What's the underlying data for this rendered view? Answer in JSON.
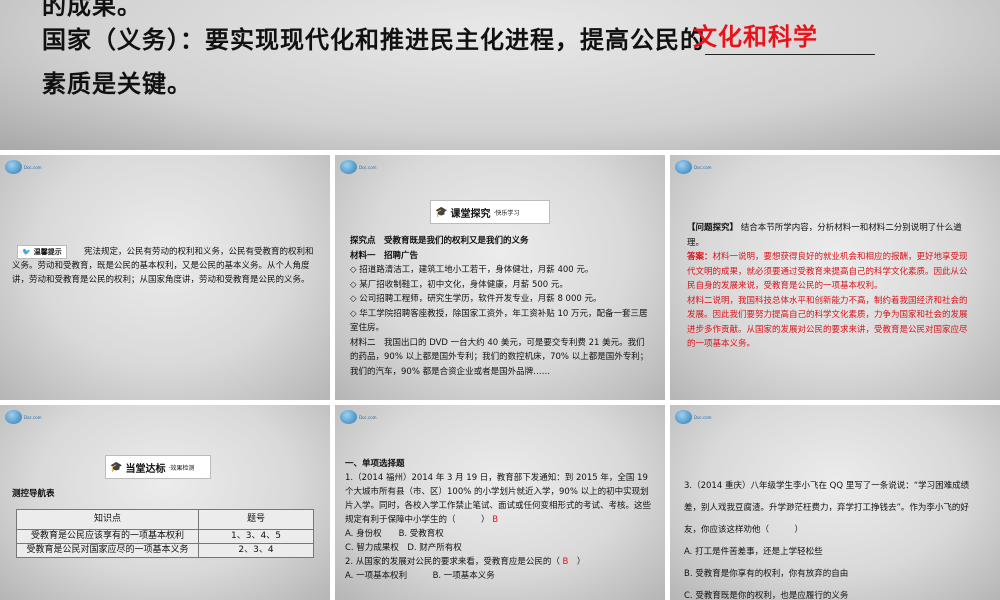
{
  "slides": [
    {
      "top_cut": "的成果。",
      "line1": "国家（义务）：要实现现代化和推进民主化进程，提高公民的",
      "answer": "文化和科学",
      "line2": "素质是关键。"
    },
    {
      "badge": "温馨提示",
      "text": "宪法规定，公民有劳动的权利和义务，公民有受教育的权利和义务。劳动和受教育，既是公民的基本权利，又是公民的基本义务。从个人角度讲，劳动和受教育是公民的权利；从国家角度讲，劳动和受教育是公民的义务。"
    },
    {
      "banner": "课堂探究",
      "banner_sub": "·快乐学习",
      "lines": [
        "探究点　受教育既是我们的权利又是我们的义务",
        "材料一　招聘广告",
        "◇ 招道路清洁工，建筑工地小工若干，身体健壮，月薪 400 元。",
        "◇ 某厂招收制鞋工，初中文化，身体健康，月薪 500 元。",
        "◇ 公司招聘工程师，研究生学历，软件开发专业，月薪 8 000 元。",
        "◇ 华工学院招聘客座教授，除国家工资外，年工资补贴 10 万元，配备一套三居室住房。",
        "材料二　我国出口的 DVD 一台大约 40 美元，可是要交专利费 21 美元。我们的药品，90% 以上都是国外专利；我们的数控机床，70% 以上都是国外专利；我们的汽车，90% 都是合资企业或者是国外品牌……"
      ]
    },
    {
      "label": "【问题探究】",
      "question": "结合本节所学内容，分析材料一和材料二分别说明了什么道理。",
      "answer_label": "答案：",
      "answer1": "材料一说明，要想获得良好的就业机会和相应的报酬，更好地享受现代文明的成果，就必须要通过受教育来提高自己的科学文化素质。因此从公民自身的发展来说，受教育是公民的一项基本权利。",
      "answer2": "材料二说明，我国科技总体水平和创新能力不高，制约着我国经济和社会的发展。因此我们要努力提高自己的科学文化素质，力争为国家和社会的发展进步多作贡献。从国家的发展对公民的要求来讲，受教育是公民对国家应尽的一项基本义务。"
    },
    {
      "banner": "当堂达标",
      "banner_sub": "·效果检测",
      "title": "测控导航表",
      "headers": [
        "知识点",
        "题号"
      ],
      "rows": [
        [
          "受教育是公民应该享有的一项基本权利",
          "1、3、4、5"
        ],
        [
          "受教育是公民对国家应尽的一项基本义务",
          "2、3、4"
        ]
      ]
    },
    {
      "section": "一、单项选择题",
      "q1": "1.（2014 福州）2014 年 3 月 19 日，教育部下发通知：到 2015 年，全国 19 个大城市所有县（市、区）100% 的小学划片就近入学，90% 以上的初中实现划片入学。同时，各校入学工作禁止笔试、面试或任何变相形式的考试、考核。这些规定有利于保障中小学生的（　　　）",
      "q1_answer": "B",
      "q1_opts": [
        "A. 身份权　　B. 受教育权",
        "C. 智力成果权　D. 财产所有权"
      ],
      "q2": "2. 从国家的发展对公民的要求来看，受教育应是公民的（",
      "q2_answer": "B",
      "q2_end": "　）",
      "q2_opts": "A. 一项基本权利　　　B. 一项基本义务"
    },
    {
      "q3": "3.（2014 重庆）八年级学生李小飞在 QQ 里写了一条说说：“学习困难成绩差，别人戏我豆腐渣。升学渺茫枉费力，弃学打工挣钱去”。作为李小飞的好友，你应该这样劝他（　　　）",
      "opts": [
        "A. 打工是件苦差事，还是上学轻松些",
        "B. 受教育是你享有的权利，你有放弃的自由",
        "C. 受教育既是你的权利，也是应履行的义务"
      ]
    }
  ],
  "logo": {
    "text": "Doc.com"
  }
}
